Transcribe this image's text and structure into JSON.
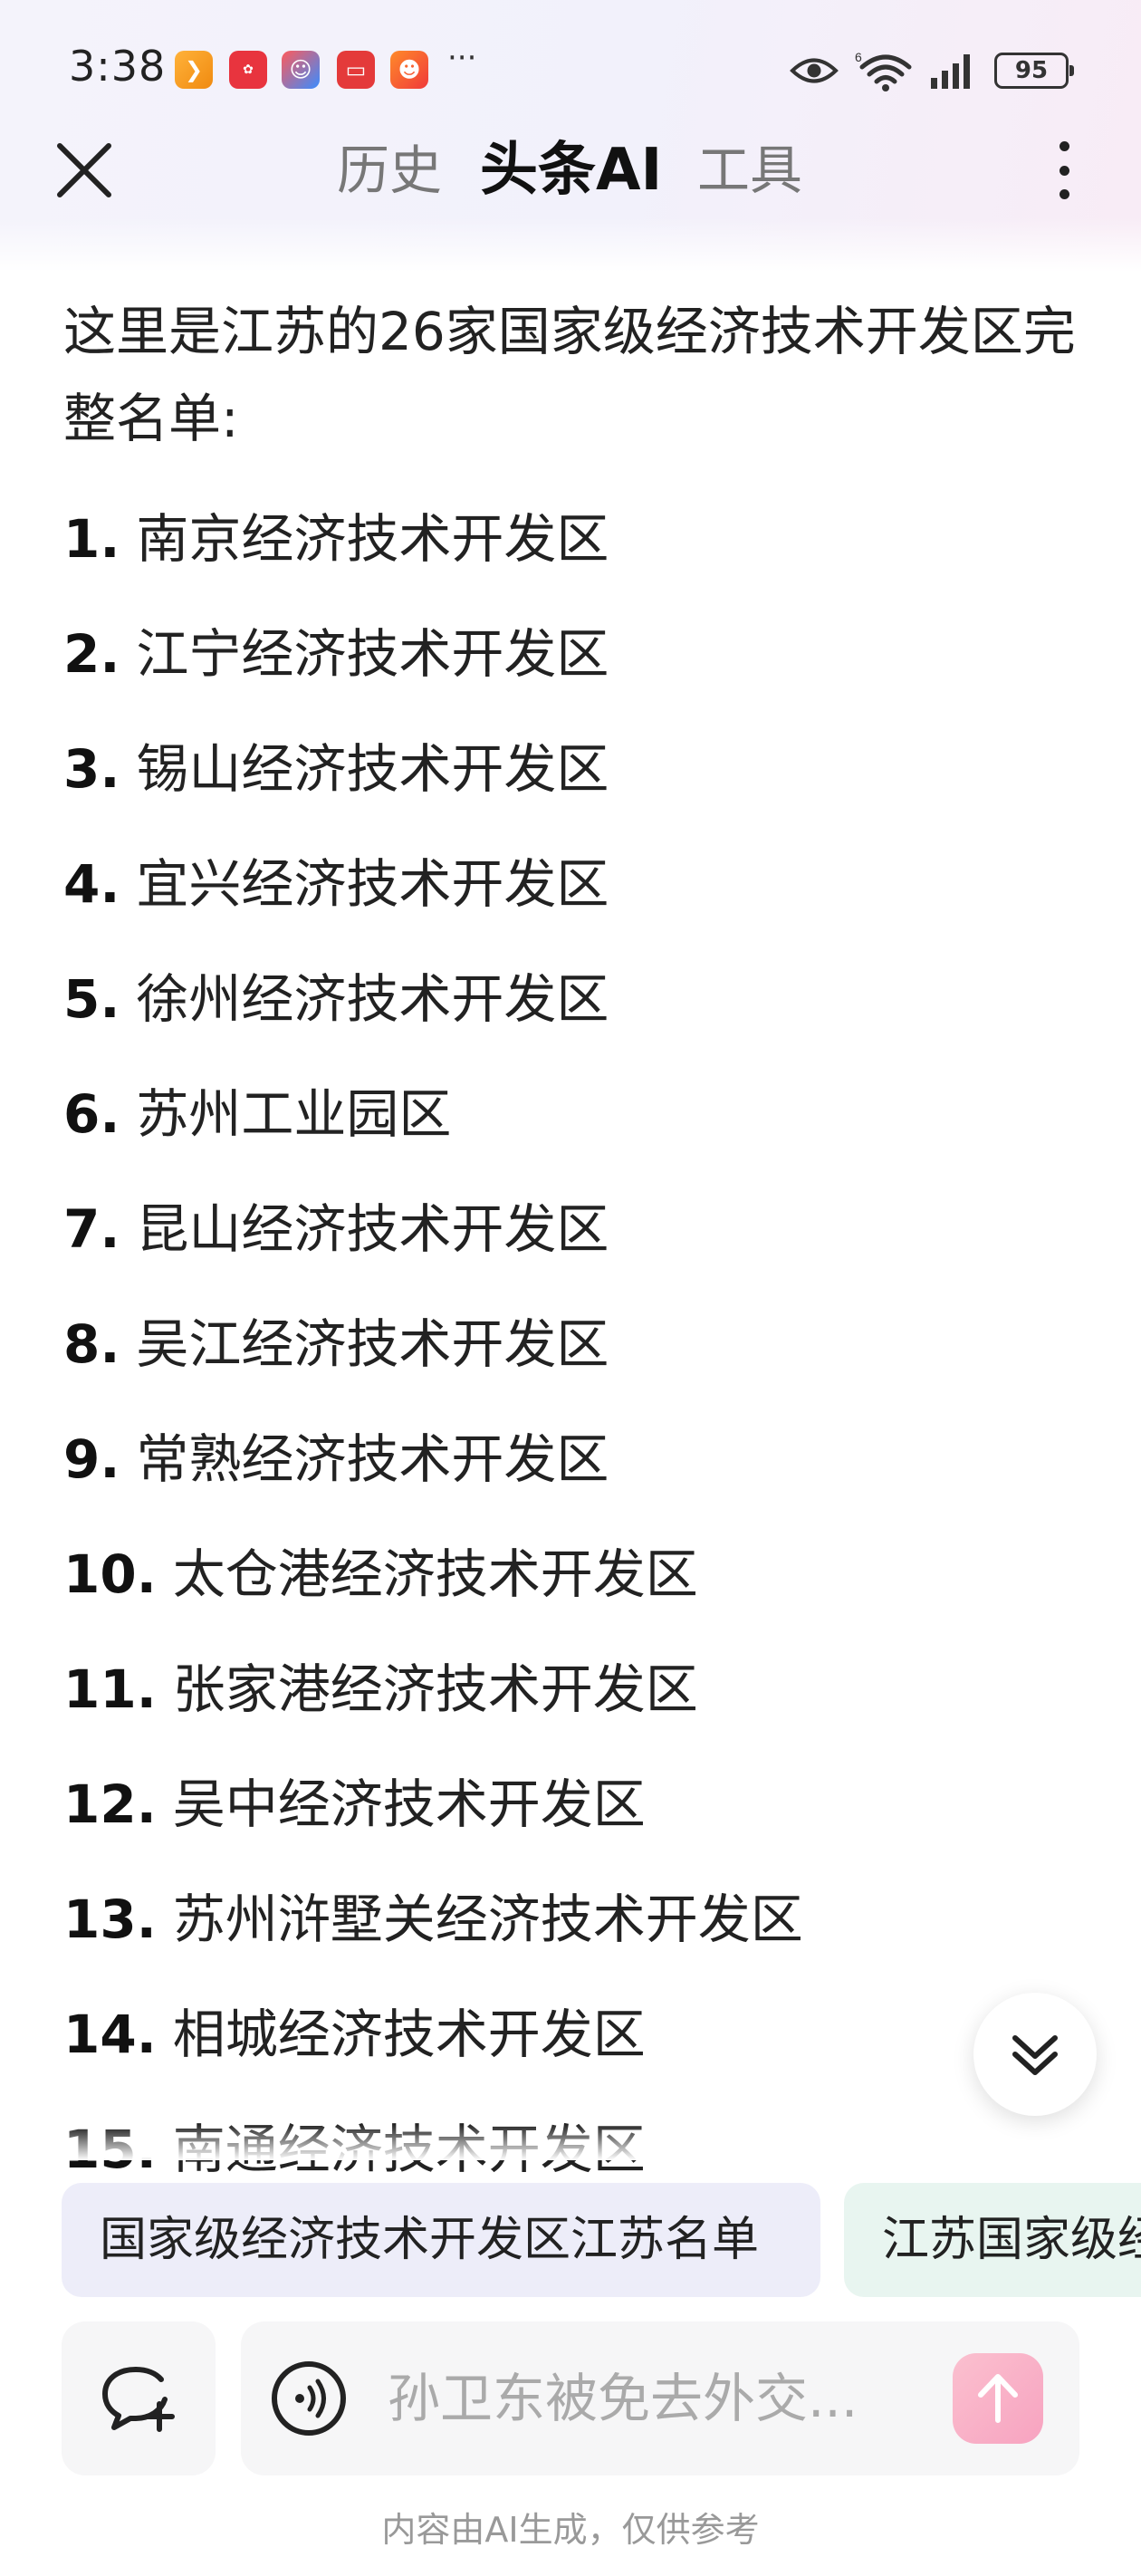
{
  "status_bar": {
    "time": "3:38",
    "battery": "95",
    "more": "···",
    "network_badge": "6"
  },
  "header": {
    "tabs": [
      {
        "label": "历史"
      },
      {
        "label": "头条AI"
      },
      {
        "label": "工具"
      }
    ]
  },
  "message": {
    "intro": "这里是江苏的26家国家级经济技术开发区完整名单:",
    "items": [
      {
        "num": "1.",
        "text": "南京经济技术开发区"
      },
      {
        "num": "2.",
        "text": "江宁经济技术开发区"
      },
      {
        "num": "3.",
        "text": "锡山经济技术开发区"
      },
      {
        "num": "4.",
        "text": "宜兴经济技术开发区"
      },
      {
        "num": "5.",
        "text": "徐州经济技术开发区"
      },
      {
        "num": "6.",
        "text": "苏州工业园区"
      },
      {
        "num": "7.",
        "text": "昆山经济技术开发区"
      },
      {
        "num": "8.",
        "text": "吴江经济技术开发区"
      },
      {
        "num": "9.",
        "text": "常熟经济技术开发区"
      },
      {
        "num": "10.",
        "text": "太仓港经济技术开发区"
      },
      {
        "num": "11.",
        "text": "张家港经济技术开发区"
      },
      {
        "num": "12.",
        "text": "吴中经济技术开发区"
      },
      {
        "num": "13.",
        "text": "苏州浒墅关经济技术开发区"
      },
      {
        "num": "14.",
        "text": "相城经济技术开发区"
      },
      {
        "num": "15.",
        "text": "南通经济技术开发区"
      }
    ]
  },
  "suggestions": [
    {
      "label": "国家级经济技术开发区江苏名单"
    },
    {
      "label": "江苏国家级经济"
    }
  ],
  "input": {
    "placeholder": "孙卫东被免去外交..."
  },
  "footer": {
    "disclaimer": "内容由AI生成，仅供参考"
  },
  "colors": {
    "accent_send": "#f7a3c0",
    "chip_primary_bg": "#ededf9",
    "chip_secondary_bg": "#e8f5f0",
    "header_gradient_end": "#f8ecf6"
  }
}
